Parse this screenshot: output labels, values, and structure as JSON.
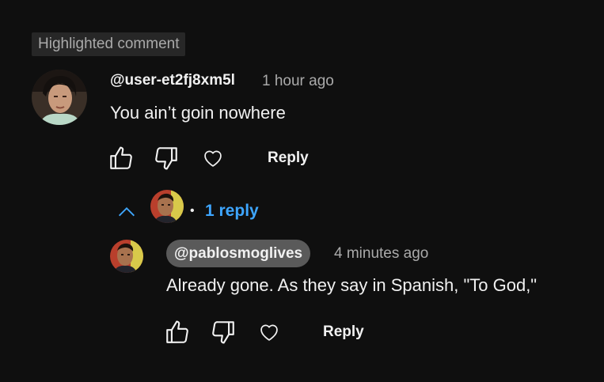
{
  "highlight_label": "Highlighted comment",
  "comment": {
    "author": "@user-et2fj8xm5l",
    "time": "1 hour ago",
    "text": "You ain’t goin nowhere",
    "actions": {
      "like_icon": "thumb-up-icon",
      "dislike_icon": "thumb-down-icon",
      "heart_icon": "heart-icon",
      "reply_label": "Reply"
    }
  },
  "replies_toggle": {
    "chevron_icon": "chevron-up-icon",
    "separator": "•",
    "count_label": "1 reply"
  },
  "reply": {
    "author": "@pablosmoglives",
    "time": "4 minutes ago",
    "text": "Already gone.  As they say in Spanish, \"To God,\"",
    "actions": {
      "like_icon": "thumb-up-icon",
      "dislike_icon": "thumb-down-icon",
      "heart_icon": "heart-icon",
      "reply_label": "Reply"
    }
  },
  "colors": {
    "background": "#0f0f0f",
    "text": "#f1f1f1",
    "secondary_text": "#aaaaaa",
    "link_blue": "#3ea6ff",
    "chip_background": "#272727",
    "author_chip": "#5a5a5a"
  }
}
